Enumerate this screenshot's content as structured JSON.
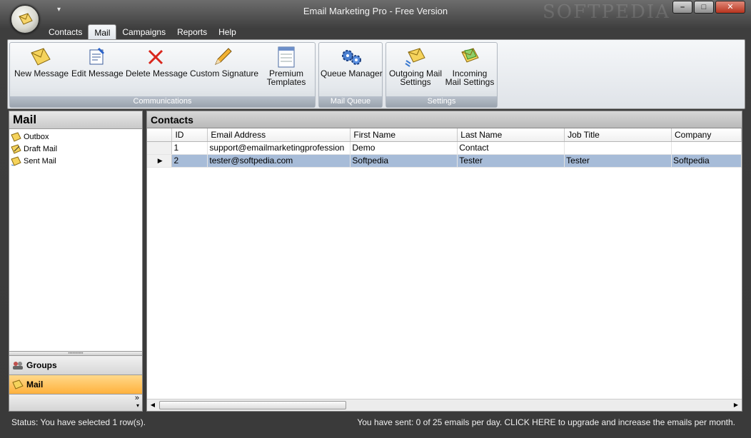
{
  "window": {
    "title": "Email Marketing Pro - Free Version",
    "watermark": "SOFTPEDIA",
    "qat_glyph": "▾"
  },
  "controls": {
    "minimize": "–",
    "maximize": "□",
    "close": "✕"
  },
  "menu_tabs": [
    {
      "label": "Contacts",
      "active": false
    },
    {
      "label": "Mail",
      "active": true
    },
    {
      "label": "Campaigns",
      "active": false
    },
    {
      "label": "Reports",
      "active": false
    },
    {
      "label": "Help",
      "active": false
    }
  ],
  "ribbon": {
    "groups": [
      {
        "label": "Communications",
        "buttons": [
          {
            "label": "New Message",
            "icon": "envelope-icon"
          },
          {
            "label": "Edit Message",
            "icon": "edit-document-icon"
          },
          {
            "label": "Delete Message",
            "icon": "red-x-icon"
          },
          {
            "label": "Custom Signature",
            "icon": "pencil-icon"
          },
          {
            "label": "Premium Templates",
            "icon": "template-icon"
          }
        ]
      },
      {
        "label": "Mail Queue",
        "buttons": [
          {
            "label": "Queue Manager",
            "icon": "gears-icon"
          }
        ]
      },
      {
        "label": "Settings",
        "buttons": [
          {
            "label": "Outgoing Mail Settings",
            "icon": "outgoing-mail-icon"
          },
          {
            "label": "Incoming Mail Settings",
            "icon": "incoming-mail-icon"
          }
        ]
      }
    ]
  },
  "left_pane": {
    "title": "Mail",
    "tree": [
      {
        "label": "Outbox",
        "icon": "envelope-icon"
      },
      {
        "label": "Draft Mail",
        "icon": "draft-mail-icon"
      },
      {
        "label": "Sent Mail",
        "icon": "sent-mail-icon"
      }
    ],
    "nav_buttons": [
      {
        "label": "Groups",
        "icon": "groups-icon",
        "active": false
      },
      {
        "label": "Mail",
        "icon": "envelope-icon",
        "active": true
      }
    ],
    "overflow_glyph": "»"
  },
  "contacts": {
    "title": "Contacts",
    "columns": [
      "ID",
      "Email Address",
      "First Name",
      "Last Name",
      "Job Title",
      "Company"
    ],
    "rows": [
      {
        "marker": "",
        "selected": false,
        "cells": [
          "1",
          "support@emailmarketingprofession",
          "Demo",
          "Contact",
          "",
          ""
        ]
      },
      {
        "marker": "▶",
        "selected": true,
        "cells": [
          "2",
          "tester@softpedia.com",
          "Softpedia",
          "Tester",
          "Tester",
          "Softpedia"
        ]
      }
    ]
  },
  "status": {
    "left": "Status: You have selected 1 row(s).",
    "right": "You have sent: 0 of 25 emails per day. CLICK HERE to upgrade and increase the emails per month."
  },
  "colors": {
    "selection": "#a7bcd8",
    "active_nav": "#ffb13d",
    "ribbon_group_label": "#9aa3ae"
  }
}
